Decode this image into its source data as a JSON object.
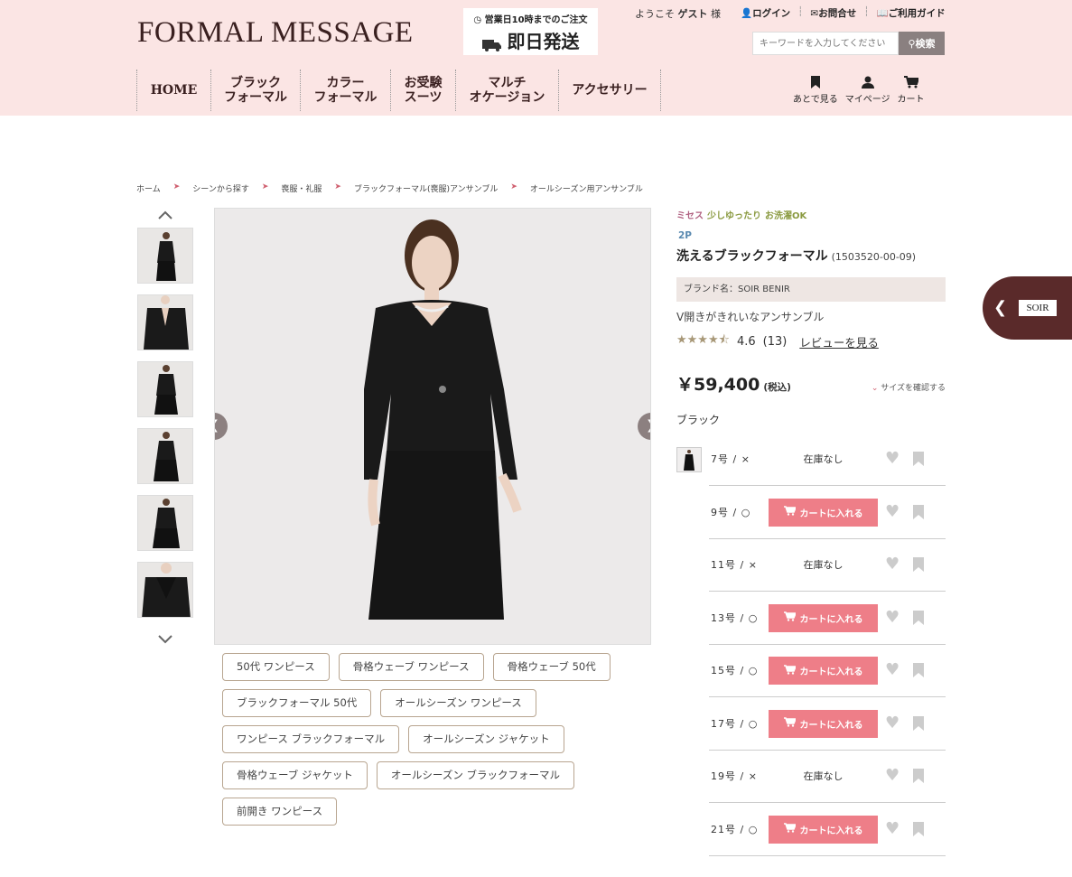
{
  "header": {
    "logo": "FORMAL MESSAGE",
    "shipping_small": "営業日10時までのご注文",
    "shipping_big": "即日発送",
    "welcome_prefix": "ようこそ",
    "welcome_user": "ゲスト",
    "welcome_suffix": "様",
    "login": "ログイン",
    "contact": "お問合せ",
    "guide": "ご利用ガイド",
    "search_placeholder": "キーワードを入力してください",
    "search_button": "検索"
  },
  "nav": [
    {
      "label": "HOME"
    },
    {
      "label": "ブラック\nフォーマル"
    },
    {
      "label": "カラー\nフォーマル"
    },
    {
      "label": "お受験\nスーツ"
    },
    {
      "label": "マルチ\nオケージョン"
    },
    {
      "label": "アクセサリー"
    }
  ],
  "header_icons": {
    "later": "あとで見る",
    "mypage": "マイページ",
    "cart": "カート"
  },
  "breadcrumb": [
    "ホーム",
    "シーンから探す",
    "喪服・礼服",
    "ブラックフォーマル(喪服)アンサンブル",
    "オールシーズン用アンサンブル"
  ],
  "tags": [
    "50代 ワンピース",
    "骨格ウェーブ ワンピース",
    "骨格ウェーブ 50代",
    "ブラックフォーマル 50代",
    "オールシーズン ワンピース",
    "ワンピース ブラックフォーマル",
    "オールシーズン ジャケット",
    "骨格ウェーブ ジャケット",
    "オールシーズン ブラックフォーマル",
    "前開き ワンピース"
  ],
  "product": {
    "badges": [
      {
        "text": "ミセス",
        "color": "#b06080"
      },
      {
        "text": "少しゆったり",
        "color": "#8a9a40"
      },
      {
        "text": "お洗濯OK",
        "color": "#8a9a40"
      }
    ],
    "set_label": "2P",
    "name": "洗えるブラックフォーマル",
    "code": "(1503520-00-09)",
    "brand": "ブランド名：SOIR BENIR",
    "catch": "V開きがきれいなアンサンブル",
    "rating": "4.6",
    "review_count": "(13)",
    "review_link": "レビューを見る",
    "price": "￥59,400",
    "tax": "(税込)",
    "size_check": "サイズを確認する",
    "color": "ブラック"
  },
  "sizes": [
    {
      "size": "7号 / ×",
      "status": "在庫なし",
      "in_stock": false
    },
    {
      "size": "9号 / ○",
      "status": "カートに入れる",
      "in_stock": true
    },
    {
      "size": "11号 / ×",
      "status": "在庫なし",
      "in_stock": false
    },
    {
      "size": "13号 / ○",
      "status": "カートに入れる",
      "in_stock": true
    },
    {
      "size": "15号 / ○",
      "status": "カートに入れる",
      "in_stock": true
    },
    {
      "size": "17号 / ○",
      "status": "カートに入れる",
      "in_stock": true
    },
    {
      "size": "19号 / ×",
      "status": "在庫なし",
      "in_stock": false
    },
    {
      "size": "21号 / ○",
      "status": "カートに入れる",
      "in_stock": true
    }
  ],
  "side_panel": {
    "logo": "SOIR"
  },
  "colors": {
    "header_bg": "#fbe5e4",
    "cart_button": "#ee7e88",
    "brand_dark": "#5a2a2a"
  }
}
